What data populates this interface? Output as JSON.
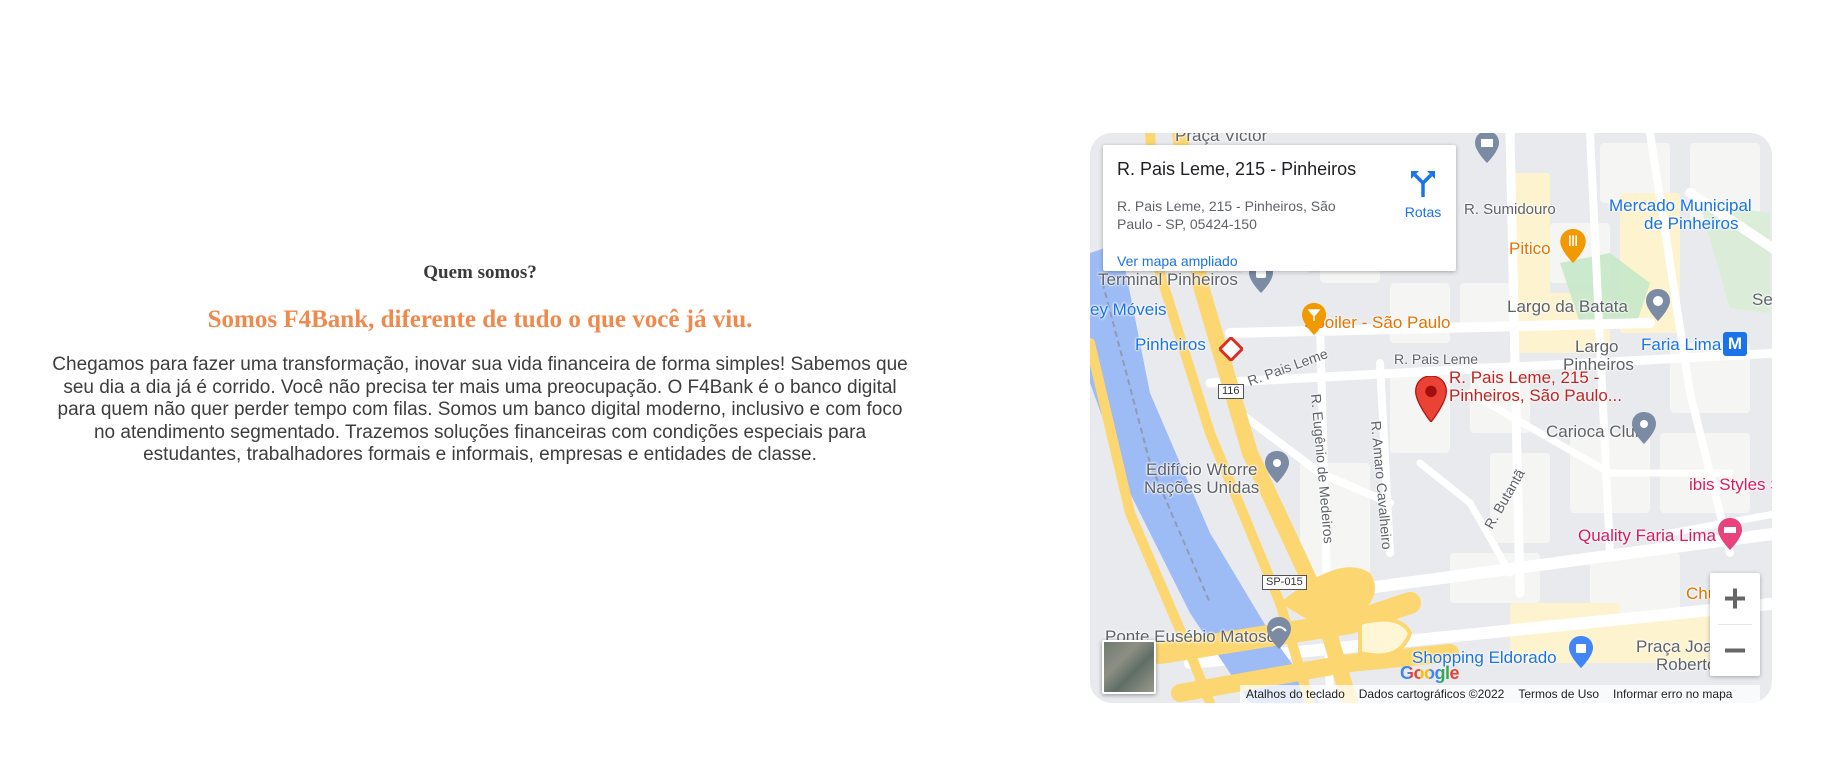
{
  "about": {
    "kicker": "Quem somos?",
    "headline": "Somos F4Bank, diferente de tudo o que você já viu.",
    "body": "Chegamos para fazer uma transformação, inovar sua vida financeira de forma simples! Sabemos que seu dia a dia já é corrido. Você não precisa ter mais uma preocupação. O F4Bank é o banco digital para quem não quer perder tempo com filas. Somos um banco digital moderno, inclusivo e com foco no atendimento segmentado. Trazemos soluções financeiras com condições especiais para estudantes, trabalhadores formais e informais, empresas e entidades de classe."
  },
  "map": {
    "card": {
      "title": "R. Pais Leme, 215 - Pinheiros",
      "address": "R. Pais Leme, 215 - Pinheiros, São Paulo - SP, 05424-150",
      "larger_map_link": "Ver mapa ampliado",
      "directions_label": "Rotas"
    },
    "labels": {
      "praca_victor": "Praça Victor",
      "r_sumidouro": "R. Sumidouro",
      "mercado_line1": "Mercado Municipal",
      "mercado_line2": "de Pinheiros",
      "pitico": "Pitico",
      "terminal": "Terminal Pinheiros",
      "moveis": "ey Móveis",
      "spoiler": "Spoiler - São Paulo",
      "largo_batata": "Largo da Batata",
      "se": "Se",
      "pinheiros_station": "Pinheiros",
      "r_pais_leme_1": "R. Pais Leme",
      "r_pais_leme_2": "R. Pais Leme",
      "largo_pinheiros_1": "Largo",
      "largo_pinheiros_2": "Pinheiros",
      "faria_lima": "Faria Lima",
      "metro_badge": "M",
      "route_116": "116",
      "pin_line1": "R. Pais Leme, 215 -",
      "pin_line2": "Pinheiros, São Paulo...",
      "carioca": "Carioca Club",
      "edificio_1": "Edifício Wtorre",
      "edificio_2": "Nações Unidas",
      "r_eugenio": "R. Eugênio de Medeiros",
      "r_amaro": "R. Amaro Cavalheiro",
      "r_butanta": "R. Butantã",
      "ibis": "ibis Styles SP",
      "quality": "Quality Faria Lima",
      "sp015": "SP-015",
      "churra": "Churra",
      "ponte": "Ponte Eusébio Matoso",
      "shopping": "Shopping Eldorado",
      "praca_joaquim_1": "Praça Joaquim",
      "praca_joaquim_2": "Roberto"
    },
    "google_logo": "Google",
    "attribution": {
      "shortcuts": "Atalhos do teclado",
      "data": "Dados cartográficos ©2022",
      "terms": "Termos de Uso",
      "report": "Informar erro no mapa"
    },
    "colors": {
      "water": "#9dbbf5",
      "highway": "#fcd771",
      "park": "#c6e8c8",
      "accent_blue": "#1a73e8",
      "pin_red": "#ea4335",
      "headline_orange": "#f0894d"
    }
  }
}
